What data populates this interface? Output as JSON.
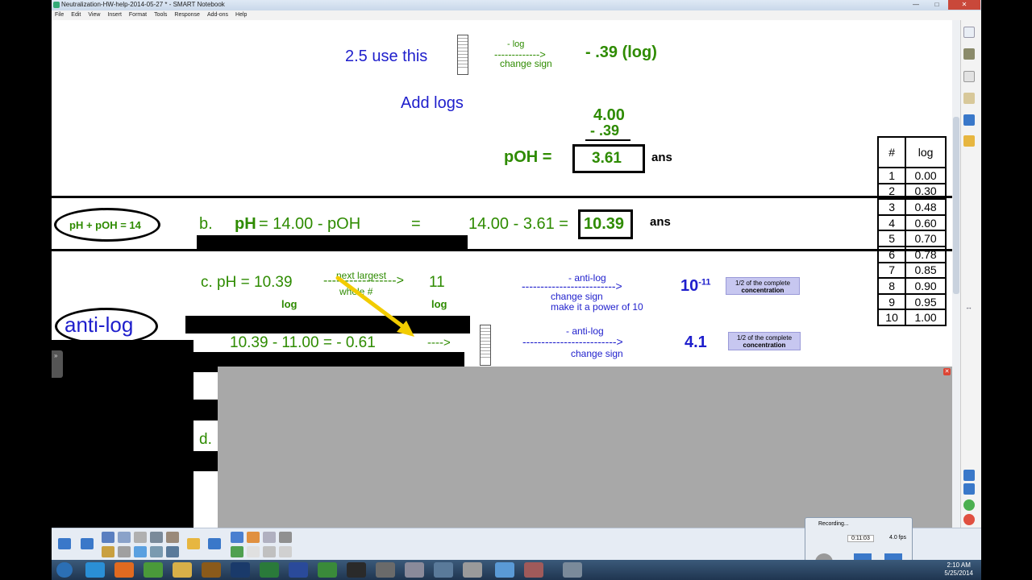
{
  "window": {
    "title": "Neutralization-HW-help-2014-05-27 * - SMART Notebook",
    "menu": [
      "File",
      "Edit",
      "View",
      "Insert",
      "Format",
      "Tools",
      "Response",
      "Add-ons",
      "Help"
    ]
  },
  "content": {
    "line1": {
      "use_this": "2.5  use this",
      "neg_log": "- log",
      "arrow": "------------->",
      "change_sign": "change sign",
      "result": "-  .39  (log)"
    },
    "add_logs": "Add logs",
    "sub_top": "4.00",
    "sub_bottom": "-  .39",
    "poh_label": "pOH  =",
    "poh_value": "3.61",
    "ans1": "ans",
    "ph_poh_oval": "pH + pOH = 14",
    "b_letter": "b.",
    "ph_label": "pH",
    "b_rest": "= 14.00 - pOH",
    "b_eq": "=",
    "b_calc": "14.00 - 3.61 =",
    "b_value": "10.39",
    "ans2": "ans",
    "c_line": "c.  pH = 10.39",
    "c_arrow": "----------------->",
    "c_eleven": "11",
    "next_largest": "next largest",
    "whole": "whole #",
    "log_left": "log",
    "log_right": "log",
    "anti_log_oval": "anti-log",
    "anti1_label": "- anti-log",
    "anti1_arrow": "------------------------->",
    "anti1_change": "change sign",
    "anti1_power": "make it a power of 10",
    "ten_base": "10",
    "ten_exp": "-11",
    "note1_line1": "1/2 of the complete",
    "note1_line2": "concentration",
    "c_calc": "10.39 - 11.00 =   - 0.61",
    "c_calc_arrow": "---->",
    "anti2_label": "- anti-log",
    "anti2_arrow": "------------------------->",
    "anti2_change": "change sign",
    "result2": "4.1",
    "note2_line1": "1/2 of the complete",
    "note2_line2": "concentration",
    "d_letter": "d."
  },
  "log_table": {
    "headers": [
      "#",
      "log"
    ],
    "rows": [
      [
        "1",
        "0.00"
      ],
      [
        "2",
        "0.30"
      ],
      [
        "3",
        "0.48"
      ],
      [
        "4",
        "0.60"
      ],
      [
        "5",
        "0.70"
      ],
      [
        "6",
        "0.78"
      ],
      [
        "7",
        "0.85"
      ],
      [
        "8",
        "0.90"
      ],
      [
        "9",
        "0.95"
      ],
      [
        "10",
        "1.00"
      ]
    ]
  },
  "recorder": {
    "title": "Recording...",
    "time": "0:11:03",
    "fps": "4.0 fps"
  },
  "clock": {
    "time": "2:10 AM",
    "date": "5/25/2014"
  }
}
